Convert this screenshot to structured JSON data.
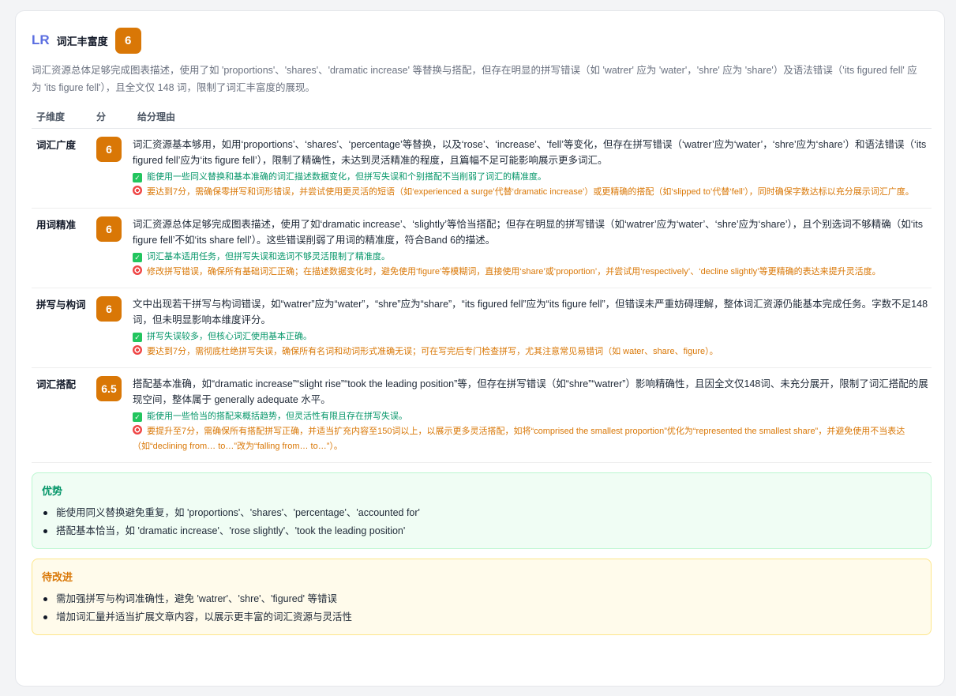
{
  "criterion": {
    "code": "LR",
    "title": "词汇丰富度",
    "score": "6",
    "summary": "词汇资源总体足够完成图表描述，使用了如 'proportions'、'shares'、'dramatic increase' 等替换与搭配，但存在明显的拼写错误（如 'watrer' 应为 'water'，'shre' 应为 'share'）及语法错误（'its figured fell' 应为 'its figure fell'），且全文仅 148 词，限制了词汇丰富度的展现。"
  },
  "table": {
    "headers": [
      "子维度",
      "分",
      "给分理由"
    ],
    "rows": [
      {
        "dimension": "词汇广度",
        "score": "6",
        "reason": "词汇资源基本够用，如用‘proportions’、‘shares’、‘percentage’等替换，以及‘rose’、‘increase’、‘fell’等变化，但存在拼写错误（‘watrer’应为‘water’，‘shre’应为‘share’）和语法错误（‘its figured fell’应为‘its figure fell’），限制了精确性，未达到灵活精准的程度，且篇幅不足可能影响展示更多词汇。",
        "good": "能使用一些同义替换和基本准确的词汇描述数据变化，但拼写失误和个别搭配不当削弱了词汇的精准度。",
        "tip": "要达到7分，需确保零拼写和词形错误，并尝试使用更灵活的短语（如‘experienced a surge’代替‘dramatic increase’）或更精确的搭配（如‘slipped to’代替‘fell’），同时确保字数达标以充分展示词汇广度。"
      },
      {
        "dimension": "用词精准",
        "score": "6",
        "reason": "词汇资源总体足够完成图表描述，使用了如‘dramatic increase’、‘slightly’等恰当搭配；但存在明显的拼写错误（如‘watrer’应为‘water’、‘shre’应为‘share’），且个别选词不够精确（如‘its figure fell’不如‘its share fell’）。这些错误削弱了用词的精准度，符合Band 6的描述。",
        "good": "词汇基本适用任务，但拼写失误和选词不够灵活限制了精准度。",
        "tip": "修改拼写错误，确保所有基础词汇正确；在描述数据变化时，避免使用‘figure’等模糊词，直接使用‘share’或‘proportion’，并尝试用‘respectively’、‘decline slightly’等更精确的表达来提升灵活度。"
      },
      {
        "dimension": "拼写与构词",
        "score": "6",
        "reason": "文中出现若干拼写与构词错误，如“watrer”应为“water”，“shre”应为“share”，“its figured fell”应为“its figure fell”，但错误未严重妨碍理解，整体词汇资源仍能基本完成任务。字数不足148词，但未明显影响本维度评分。",
        "good": "拼写失误较多，但核心词汇使用基本正确。",
        "tip": "要达到7分，需彻底杜绝拼写失误，确保所有名词和动词形式准确无误；可在写完后专门检查拼写，尤其注意常见易错词（如 water、share、figure）。"
      },
      {
        "dimension": "词汇搭配",
        "score": "6.5",
        "reason": "搭配基本准确，如“dramatic increase”“slight rise”“took the leading position”等，但存在拼写错误（如“shre”“watrer”）影响精确性，且因全文仅148词、未充分展开，限制了词汇搭配的展现空间，整体属于 generally adequate 水平。",
        "good": "能使用一些恰当的搭配来概括趋势，但灵活性有限且存在拼写失误。",
        "tip": "要提升至7分，需确保所有搭配拼写正确，并适当扩充内容至150词以上，以展示更多灵活搭配，如将“comprised the smallest proportion”优化为“represented the smallest share”，并避免使用不当表达（如“declining from… to…”改为“falling from… to…”）。"
      }
    ]
  },
  "strengths": {
    "title": "优势",
    "items": [
      "能使用同义替换避免重复，如 'proportions'、'shares'、'percentage'、'accounted for'",
      "搭配基本恰当，如 'dramatic increase'、'rose slightly'、'took the leading position'"
    ]
  },
  "improvements": {
    "title": "待改进",
    "items": [
      "需加强拼写与构词准确性，避免 'watrer'、'shre'、'figured' 等错误",
      "增加词汇量并适当扩展文章内容，以展示更丰富的词汇资源与灵活性"
    ]
  },
  "colors": {
    "accent": "#5b6ee1",
    "score_badge": "#d97706",
    "good_text": "#059669",
    "tip_text": "#d97706"
  },
  "icons": {
    "good": "check-box-icon",
    "tip": "target-icon"
  }
}
